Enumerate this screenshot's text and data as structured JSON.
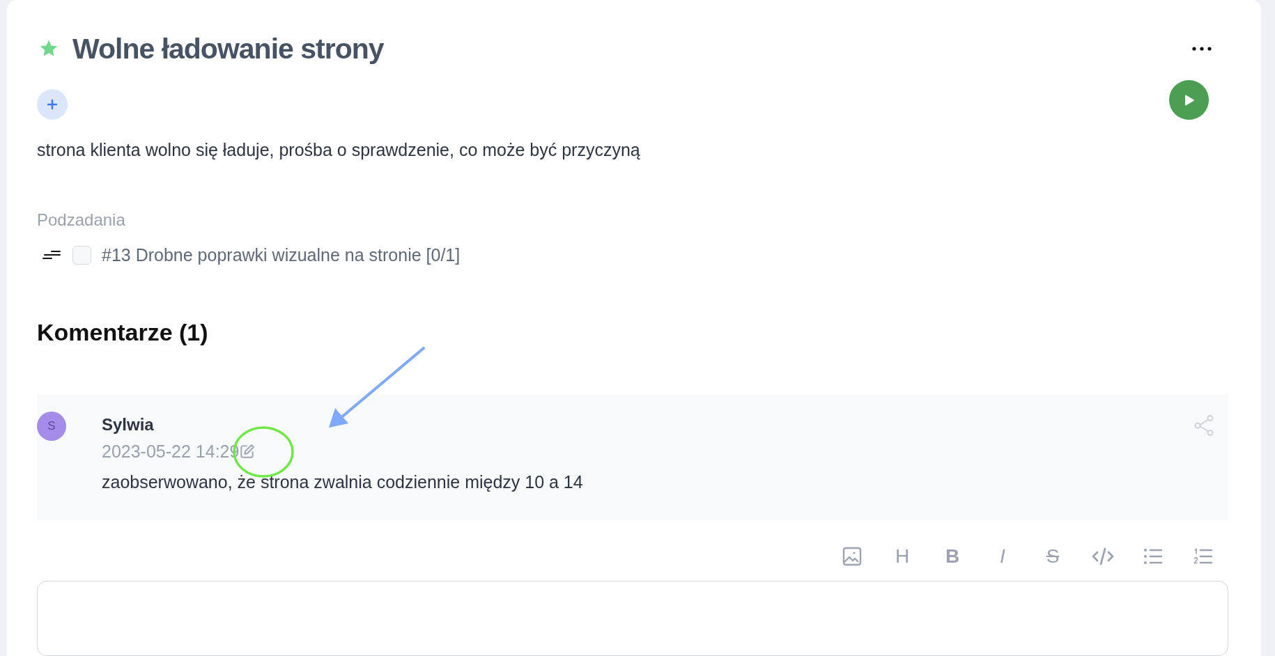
{
  "task": {
    "title": "Wolne ładowanie strony",
    "starred": true,
    "description": "strona klienta wolno się ładuje, prośba o sprawdzenie, co może być przyczyną"
  },
  "subtasks": {
    "heading": "Podzadania",
    "items": [
      {
        "label": "#13 Drobne poprawki wizualne na stronie [0/1]",
        "checked": false
      }
    ]
  },
  "comments": {
    "heading": "Komentarze (1)",
    "items": [
      {
        "avatar": "S",
        "author": "Sylwia",
        "date": "2023-05-22 14:29",
        "text": "zaobserwowano, że strona zwalnia codziennie między 10 a 14"
      }
    ]
  },
  "editor_toolbar": [
    {
      "kind": "image"
    },
    {
      "kind": "heading",
      "label": "H"
    },
    {
      "kind": "bold",
      "label": "B"
    },
    {
      "kind": "italic",
      "label": "I"
    },
    {
      "kind": "strike",
      "label": "S"
    },
    {
      "kind": "code"
    },
    {
      "kind": "bullets"
    },
    {
      "kind": "numbers"
    }
  ],
  "annotations": [
    {
      "kind": "arrow",
      "color": "#7eaaf7"
    },
    {
      "kind": "ellipse",
      "color": "#6ee843"
    }
  ]
}
